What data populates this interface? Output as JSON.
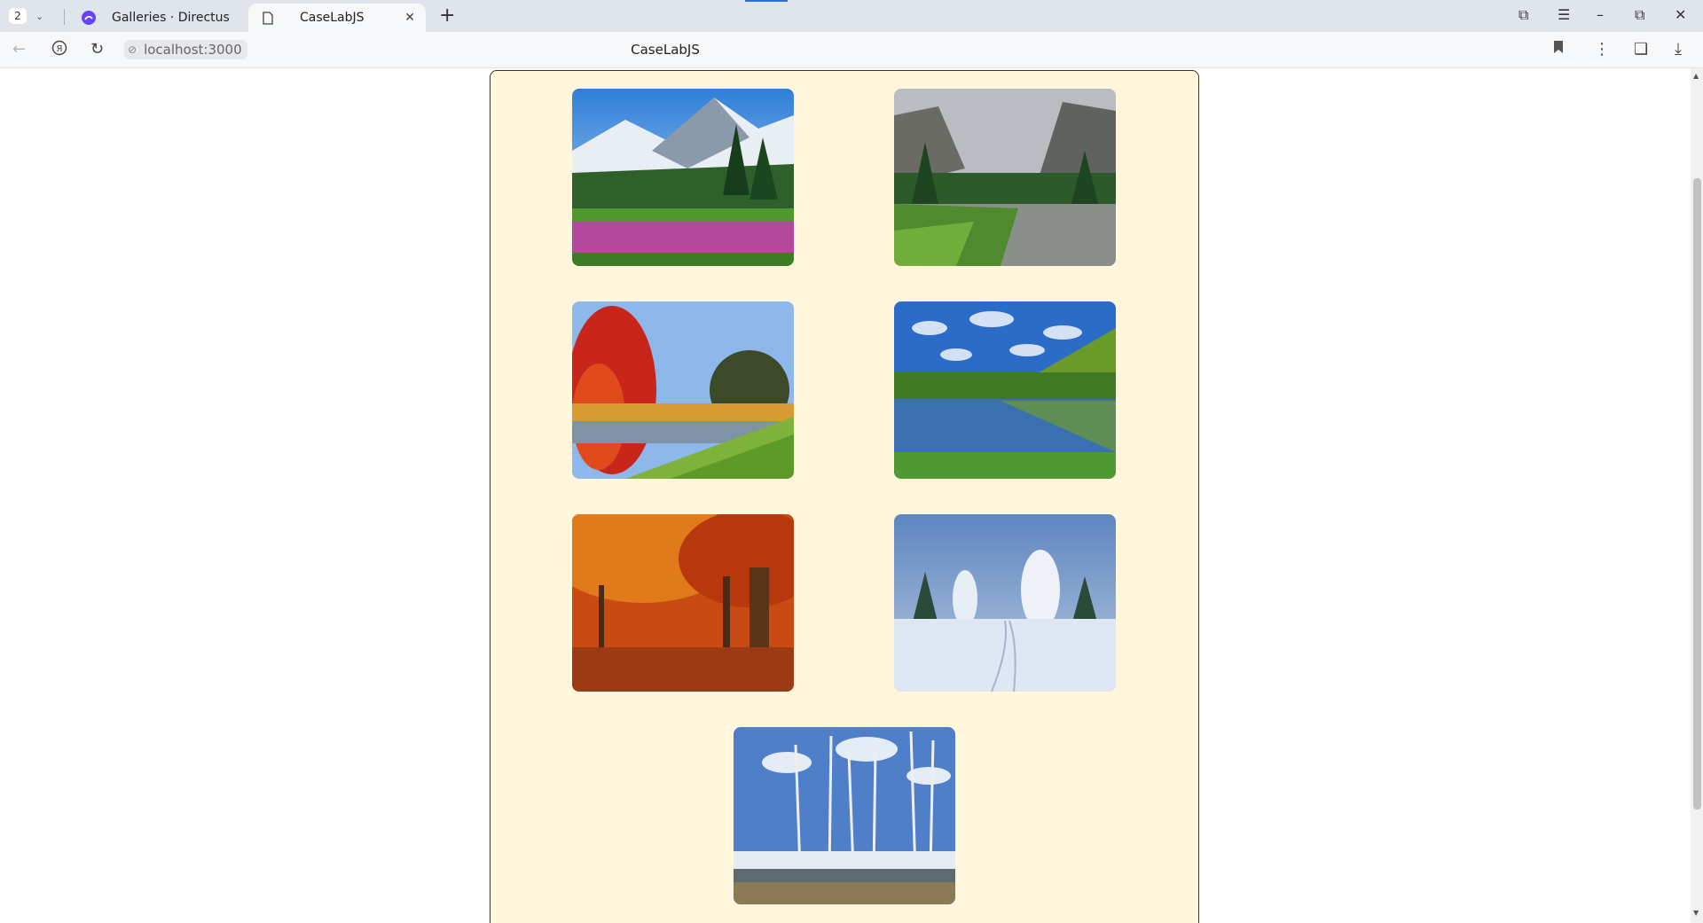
{
  "browser": {
    "tab_count": "2",
    "tabs": [
      {
        "label": "Galleries · Directus",
        "active": false
      },
      {
        "label": "CaseLabJS",
        "active": true
      }
    ],
    "url": "localhost:3000",
    "page_title": "CaseLabJS"
  },
  "gallery": {
    "background": "#fff6dc",
    "images": [
      {
        "scene": "mountain-meadow-flowers"
      },
      {
        "scene": "misty-valley-river"
      },
      {
        "scene": "autumn-red-tree-lake"
      },
      {
        "scene": "green-valley-reflection"
      },
      {
        "scene": "orange-autumn-forest"
      },
      {
        "scene": "snowy-winter-trail"
      },
      {
        "scene": "birch-trees-spring-melt"
      }
    ]
  }
}
